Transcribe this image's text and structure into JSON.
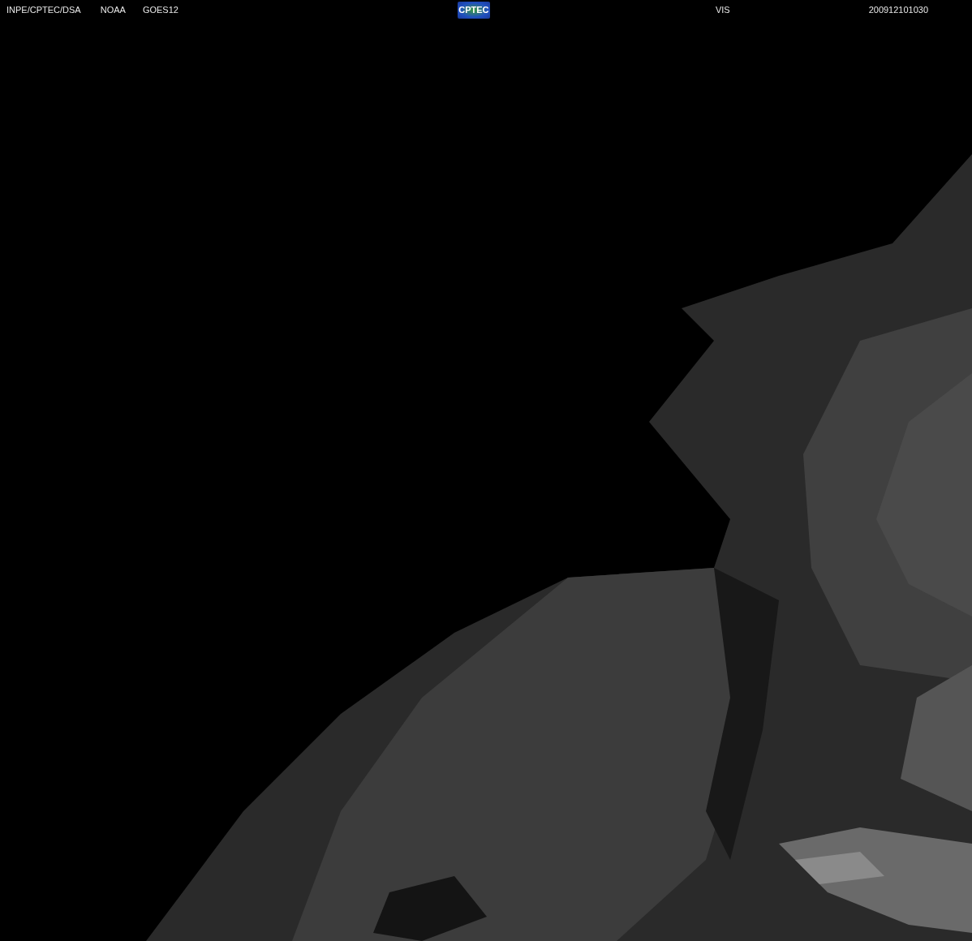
{
  "header": {
    "source": "INPE/CPTEC/DSA",
    "agency": "NOAA",
    "satellite": "GOES12",
    "logo": "CPTEC",
    "channel": "VIS",
    "timestamp": "200912101030"
  }
}
